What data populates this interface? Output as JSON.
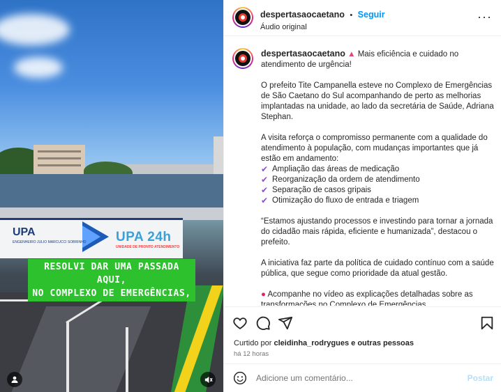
{
  "post": {
    "username": "despertasaocaetano",
    "follow_label": "Seguir",
    "audio": "Áudio original",
    "separator": "•",
    "caption_username": "despertasaocaetano",
    "caption_intro": "Mais eficiência e cuidado no atendimento de urgência!",
    "paragraph1": "O prefeito Tite Campanella esteve no Complexo de Emergências de São Caetano do Sul acompanhando de perto as melhorias implantadas na unidade, ao lado da secretária de Saúde, Adriana Stephan.",
    "paragraph2": "A visita reforça o compromisso permanente com a qualidade do atendimento à população, com mudanças importantes que já estão em andamento:",
    "bullets": [
      "Ampliação das áreas de medicação",
      "Reorganização da ordem de atendimento",
      "Separação de casos gripais",
      "Otimização do fluxo de entrada e triagem"
    ],
    "quote": "“Estamos ajustando processos e investindo para tornar a jornada do cidadão mais rápida, eficiente e humanizada”, destacou o prefeito.",
    "paragraph3": "A iniciativa faz parte da política de cuidado contínuo com a saúde pública, que segue como prioridade da atual gestão.",
    "paragraph4": "Acompanhe no vídeo as explicações detalhadas sobre as transformações no Complexo de Emergências."
  },
  "engagement": {
    "liked_prefix": "Curtido por",
    "liked_user": "cleidinha_rodrygues",
    "liked_suffix": "e outras pessoas",
    "time_ago": "há 12 horas"
  },
  "comment": {
    "placeholder": "Adicione um comentário...",
    "post_label": "Postar"
  },
  "video": {
    "caption_line1": "RESOLVI DAR UMA PASSADA AQUI,",
    "caption_line2": "NO COMPLEXO DE EMERGÊNCIAS,",
    "sign_left_title": "UPA",
    "sign_left_sub": "ENGENHEIRO JULIO MARCUCCI SOBRINHO",
    "sign_right_title": "UPA 24h",
    "sign_right_sub": "UNIDADE DE PRONTO ATENDIMENTO"
  },
  "icons": {
    "heart": "heart-icon",
    "comment": "comment-icon",
    "share": "share-icon",
    "save": "bookmark-icon",
    "emoji": "emoji-icon",
    "more": "more-icon",
    "tagged": "tagged-user-icon",
    "mute": "mute-icon"
  },
  "colors": {
    "follow": "#0095f6",
    "caption_bg": "#2dc22d",
    "check": "#8a4fc9"
  }
}
